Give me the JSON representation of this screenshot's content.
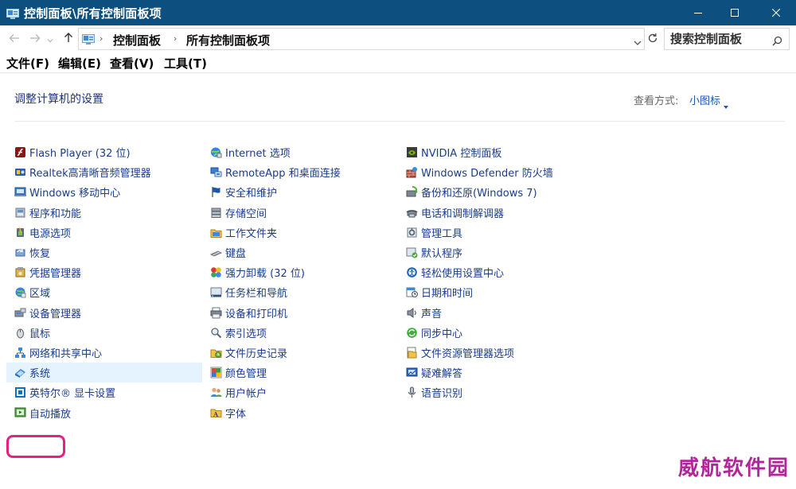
{
  "window": {
    "title": "控制面板\\所有控制面板项",
    "controls": {
      "minimize": "minimize-icon",
      "maximize": "maximize-icon",
      "close": "close-icon"
    }
  },
  "address": {
    "crumbs": [
      "控制面板",
      "所有控制面板项"
    ],
    "search_placeholder": "搜索控制面板"
  },
  "menu": [
    "文件(F)",
    "编辑(E)",
    "查看(V)",
    "工具(T)"
  ],
  "content": {
    "heading": "调整计算机的设置",
    "view_by_label": "查看方式:",
    "view_by_value": "小图标"
  },
  "columns": [
    [
      {
        "label": "Flash Player (32 位)",
        "icon": "flash-icon"
      },
      {
        "label": "Realtek高清晰音频管理器",
        "icon": "audio-manager-icon"
      },
      {
        "label": "Windows 移动中心",
        "icon": "mobility-center-icon"
      },
      {
        "label": "程序和功能",
        "icon": "programs-icon"
      },
      {
        "label": "电源选项",
        "icon": "power-icon"
      },
      {
        "label": "恢复",
        "icon": "recovery-icon"
      },
      {
        "label": "凭据管理器",
        "icon": "credential-icon"
      },
      {
        "label": "区域",
        "icon": "region-icon"
      },
      {
        "label": "设备管理器",
        "icon": "device-manager-icon"
      },
      {
        "label": "鼠标",
        "icon": "mouse-icon"
      },
      {
        "label": "网络和共享中心",
        "icon": "network-icon"
      },
      {
        "label": "系统",
        "icon": "system-icon",
        "selected": true
      },
      {
        "label": "英特尔® 显卡设置",
        "icon": "intel-graphics-icon"
      },
      {
        "label": "自动播放",
        "icon": "autoplay-icon"
      }
    ],
    [
      {
        "label": "Internet 选项",
        "icon": "internet-icon"
      },
      {
        "label": "RemoteApp 和桌面连接",
        "icon": "remoteapp-icon"
      },
      {
        "label": "安全和维护",
        "icon": "flag-icon"
      },
      {
        "label": "存储空间",
        "icon": "storage-icon"
      },
      {
        "label": "工作文件夹",
        "icon": "work-folders-icon"
      },
      {
        "label": "键盘",
        "icon": "keyboard-icon"
      },
      {
        "label": "强力卸载 (32 位)",
        "icon": "uninstall-icon"
      },
      {
        "label": "任务栏和导航",
        "icon": "taskbar-icon"
      },
      {
        "label": "设备和打印机",
        "icon": "printer-icon"
      },
      {
        "label": "索引选项",
        "icon": "indexing-icon"
      },
      {
        "label": "文件历史记录",
        "icon": "file-history-icon"
      },
      {
        "label": "颜色管理",
        "icon": "color-icon"
      },
      {
        "label": "用户帐户",
        "icon": "users-icon"
      },
      {
        "label": "字体",
        "icon": "fonts-icon"
      }
    ],
    [
      {
        "label": "NVIDIA 控制面板",
        "icon": "nvidia-icon"
      },
      {
        "label": "Windows Defender 防火墙",
        "icon": "firewall-icon"
      },
      {
        "label": "备份和还原(Windows 7)",
        "icon": "backup-icon"
      },
      {
        "label": "电话和调制解调器",
        "icon": "phone-icon"
      },
      {
        "label": "管理工具",
        "icon": "admin-tools-icon"
      },
      {
        "label": "默认程序",
        "icon": "default-programs-icon"
      },
      {
        "label": "轻松使用设置中心",
        "icon": "ease-of-access-icon"
      },
      {
        "label": "日期和时间",
        "icon": "date-time-icon"
      },
      {
        "label": "声音",
        "icon": "sound-icon"
      },
      {
        "label": "同步中心",
        "icon": "sync-icon"
      },
      {
        "label": "文件资源管理器选项",
        "icon": "folder-options-icon"
      },
      {
        "label": "疑难解答",
        "icon": "troubleshoot-icon"
      },
      {
        "label": "语音识别",
        "icon": "microphone-icon"
      }
    ]
  ],
  "watermark": "威航软件园"
}
